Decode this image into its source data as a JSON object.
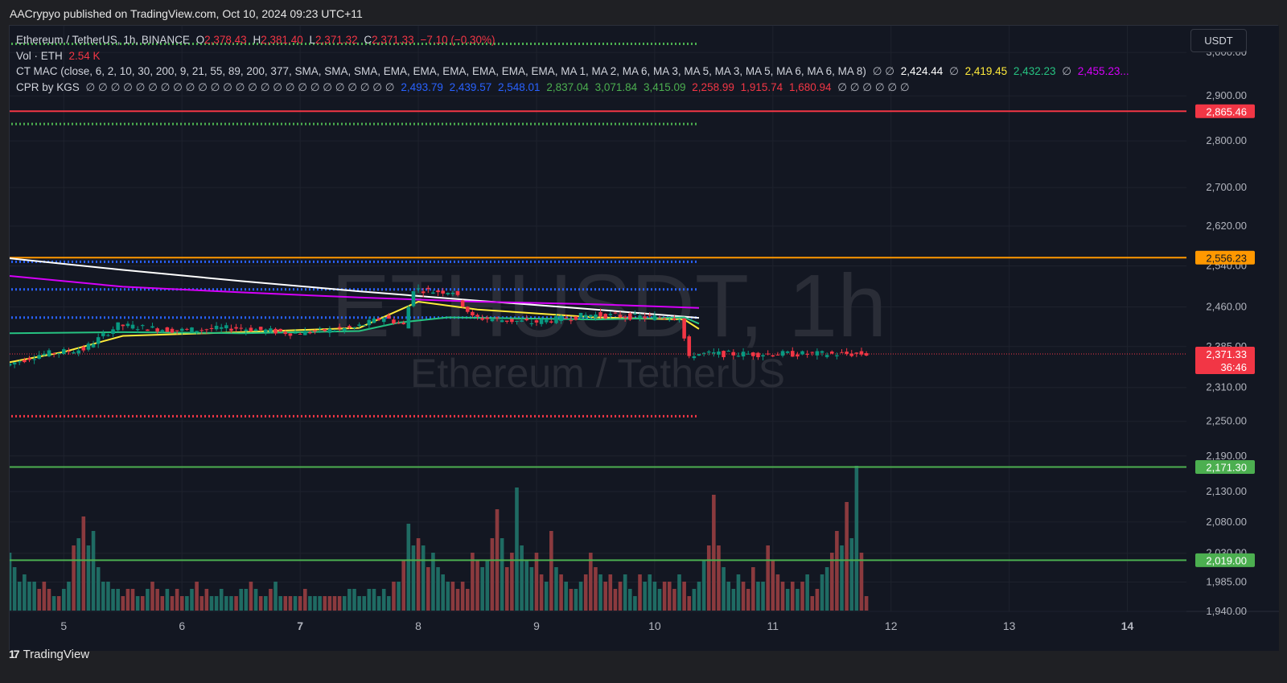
{
  "header": {
    "published_by": "AACrypyo published on TradingView.com, Oct 10, 2024 09:23 UTC+11"
  },
  "footer": {
    "brand": "TradingView",
    "logo_text": "17"
  },
  "currency": "USDT",
  "watermark": {
    "symbol": "ETHUSDT, 1h",
    "name": "Ethereum / TetherUS"
  },
  "legend": {
    "row1": {
      "symbol": "Ethereum / TetherUS, 1h, BINANCE",
      "o_label": "O",
      "o": "2,378.43",
      "h_label": "H",
      "h": "2,381.40",
      "l_label": "L",
      "l": "2,371.32",
      "c_label": "C",
      "c": "2,371.33",
      "change": "−7.10 (−0.30%)"
    },
    "row2": {
      "label": "Vol · ETH",
      "value": "2.54 K"
    },
    "row3": {
      "label": "CT MAC (close, 6, 2, 10, 30, 200, 9, 21, 55, 89, 200, 377, SMA, SMA, SMA, EMA, EMA, EMA, EMA, EMA, EMA, MA 1, MA 2, MA 6, MA 3, MA 5, MA 3, MA 5, MA 6, MA 6, MA 8)",
      "empty1": "∅ ∅",
      "v1": "2,424.44",
      "empty2": "∅",
      "v2": "2,419.45",
      "v3": "2,432.23",
      "empty3": "∅",
      "v4": "2,455.23..."
    },
    "row4": {
      "label": "CPR by KGS",
      "empty1": "∅ ∅ ∅ ∅ ∅ ∅ ∅ ∅ ∅ ∅ ∅ ∅ ∅ ∅ ∅ ∅ ∅ ∅ ∅ ∅ ∅ ∅ ∅ ∅ ∅",
      "b1": "2,493.79",
      "b2": "2,439.57",
      "b3": "2,548.01",
      "g1": "2,837.04",
      "g2": "3,071.84",
      "g3": "3,415.09",
      "r1": "2,258.99",
      "r2": "1,915.74",
      "r3": "1,680.94",
      "empty2": "∅ ∅ ∅ ∅ ∅ ∅"
    }
  },
  "colors": {
    "background": "#131722",
    "grid": "#1e222d",
    "up": "#089981",
    "down": "#f23645",
    "vol_up": "#1f6b63",
    "vol_down": "#8b3a3e",
    "cpr_green": "#4caf50",
    "cpr_blue": "#2962ff",
    "cpr_red": "#f23645",
    "ma_white": "#ffffff",
    "ma_magenta": "#d500f9",
    "ma_yellow": "#ffeb3b",
    "ma_teal": "#26c281",
    "level_red": "#f23645",
    "level_orange": "#ff9800",
    "level_green": "#4caf50"
  },
  "chart_data": {
    "type": "candlestick",
    "title": "Ethereum / TetherUS, 1h, BINANCE",
    "price_axis": {
      "ticks": [
        "3,000.00",
        "2,900.00",
        "2,800.00",
        "2,700.00",
        "2,620.00",
        "2,540.00",
        "2,460.00",
        "2,385.00",
        "2,310.00",
        "2,250.00",
        "2,190.00",
        "2,130.00",
        "2,080.00",
        "2,030.00",
        "1,985.00",
        "1,940.00"
      ],
      "scale": "log",
      "ylim": [
        1940,
        3040
      ]
    },
    "time_axis": {
      "ticks": [
        "5",
        "6",
        "7",
        "8",
        "9",
        "10",
        "11",
        "12",
        "13",
        "14"
      ],
      "bold_ticks": [
        "7",
        "14"
      ],
      "xlim": [
        "2024-10-04T13:00",
        "2024-10-14T12:00"
      ]
    },
    "price_labels": [
      {
        "value": 2865.46,
        "text": "2,865.46",
        "style": "red-line"
      },
      {
        "value": 2556.23,
        "text": "2,556.23",
        "style": "orange-line"
      },
      {
        "value": 2371.33,
        "text": "2,371.33",
        "countdown": "36:46",
        "style": "last-price"
      },
      {
        "value": 2171.3,
        "text": "2,171.30",
        "style": "green-line"
      },
      {
        "value": 2019.0,
        "text": "2,019.00",
        "style": "green-line"
      }
    ],
    "cpr_levels": [
      {
        "value": 3020,
        "color": "green"
      },
      {
        "value": 2837.04,
        "color": "green"
      },
      {
        "value": 2548.01,
        "color": "blue"
      },
      {
        "value": 2493.79,
        "color": "blue"
      },
      {
        "value": 2439.57,
        "color": "blue"
      },
      {
        "value": 2258.99,
        "color": "red"
      }
    ],
    "moving_averages": [
      {
        "color": "white",
        "points": [
          [
            "2024-10-04T13:00",
            2555
          ],
          [
            "2024-10-05T12:00",
            2532
          ],
          [
            "2024-10-06T12:00",
            2510
          ],
          [
            "2024-10-07T12:00",
            2490
          ],
          [
            "2024-10-08T12:00",
            2472
          ],
          [
            "2024-10-09T12:00",
            2455
          ],
          [
            "2024-10-10T09:00",
            2439
          ]
        ]
      },
      {
        "color": "magenta",
        "points": [
          [
            "2024-10-04T13:00",
            2520
          ],
          [
            "2024-10-05T12:00",
            2499
          ],
          [
            "2024-10-06T12:00",
            2488
          ],
          [
            "2024-10-07T12:00",
            2478
          ],
          [
            "2024-10-08T12:00",
            2470
          ],
          [
            "2024-10-09T12:00",
            2465
          ],
          [
            "2024-10-10T09:00",
            2458
          ]
        ]
      },
      {
        "color": "yellow",
        "points": [
          [
            "2024-10-04T13:00",
            2356
          ],
          [
            "2024-10-05T00:00",
            2375
          ],
          [
            "2024-10-05T12:00",
            2405
          ],
          [
            "2024-10-06T12:00",
            2412
          ],
          [
            "2024-10-07T12:00",
            2420
          ],
          [
            "2024-10-08T00:00",
            2470
          ],
          [
            "2024-10-08T12:00",
            2455
          ],
          [
            "2024-10-09T12:00",
            2440
          ],
          [
            "2024-10-10T06:00",
            2436
          ],
          [
            "2024-10-10T09:00",
            2418
          ]
        ]
      },
      {
        "color": "teal",
        "points": [
          [
            "2024-10-04T13:00",
            2410
          ],
          [
            "2024-10-05T12:00",
            2412
          ],
          [
            "2024-10-06T12:00",
            2410
          ],
          [
            "2024-10-07T12:00",
            2414
          ],
          [
            "2024-10-07T20:00",
            2430
          ],
          [
            "2024-10-08T06:00",
            2440
          ],
          [
            "2024-10-09T12:00",
            2436
          ],
          [
            "2024-10-10T06:00",
            2440
          ],
          [
            "2024-10-10T09:00",
            2428
          ]
        ]
      }
    ],
    "candles_anchor": [
      [
        "2024-10-04T13:00",
        2350
      ],
      [
        "2024-10-04T20:00",
        2370
      ],
      [
        "2024-10-05T05:00",
        2380
      ],
      [
        "2024-10-05T12:00",
        2425
      ],
      [
        "2024-10-06T00:00",
        2415
      ],
      [
        "2024-10-06T12:00",
        2420
      ],
      [
        "2024-10-07T00:00",
        2410
      ],
      [
        "2024-10-07T06:00",
        2415
      ],
      [
        "2024-10-07T12:00",
        2420
      ],
      [
        "2024-10-07T18:00",
        2440
      ],
      [
        "2024-10-07T22:00",
        2425
      ],
      [
        "2024-10-08T00:00",
        2495
      ],
      [
        "2024-10-08T04:00",
        2490
      ],
      [
        "2024-10-08T08:00",
        2490
      ],
      [
        "2024-10-08T12:00",
        2440
      ],
      [
        "2024-10-09T00:00",
        2430
      ],
      [
        "2024-10-09T12:00",
        2445
      ],
      [
        "2024-10-10T00:00",
        2440
      ],
      [
        "2024-10-10T06:00",
        2440
      ],
      [
        "2024-10-10T07:00",
        2400
      ],
      [
        "2024-10-10T08:00",
        2362
      ],
      [
        "2024-10-10T09:00",
        2371.33
      ]
    ],
    "volume_profile": [
      0.4,
      0.3,
      0.2,
      0.25,
      0.2,
      0.2,
      0.15,
      0.2,
      0.15,
      0.1,
      0.1,
      0.15,
      0.2,
      0.45,
      0.5,
      0.65,
      0.45,
      0.55,
      0.3,
      0.2,
      0.2,
      0.15,
      0.15,
      0.1,
      0.15,
      0.15,
      0.1,
      0.1,
      0.15,
      0.2,
      0.15,
      0.1,
      0.15,
      0.1,
      0.15,
      0.1,
      0.1,
      0.15,
      0.2,
      0.1,
      0.15,
      0.1,
      0.1,
      0.15,
      0.1,
      0.1,
      0.1,
      0.15,
      0.15,
      0.2,
      0.15,
      0.1,
      0.1,
      0.15,
      0.2,
      0.1,
      0.1,
      0.1,
      0.1,
      0.1,
      0.15,
      0.1,
      0.1,
      0.1,
      0.1,
      0.1,
      0.1,
      0.1,
      0.1,
      0.15,
      0.15,
      0.1,
      0.1,
      0.15,
      0.15,
      0.1,
      0.15,
      0.1,
      0.2,
      0.2,
      0.35,
      0.6,
      0.45,
      0.5,
      0.45,
      0.3,
      0.4,
      0.3,
      0.25,
      0.2,
      0.2,
      0.15,
      0.2,
      0.15,
      0.4,
      0.35,
      0.3,
      0.35,
      0.5,
      0.7,
      0.5,
      0.3,
      0.4,
      0.85,
      0.45,
      0.35,
      0.3,
      0.4,
      0.25,
      0.2,
      0.55,
      0.3,
      0.25,
      0.2,
      0.15,
      0.15,
      0.2,
      0.25,
      0.4,
      0.3,
      0.25,
      0.2,
      0.25,
      0.15,
      0.2,
      0.25,
      0.15,
      0.1,
      0.25,
      0.2,
      0.25,
      0.2,
      0.15,
      0.2,
      0.2,
      0.15,
      0.25,
      0.2,
      0.1,
      0.15,
      0.2,
      0.35,
      0.45,
      0.8,
      0.45,
      0.3,
      0.2,
      0.15,
      0.25,
      0.2,
      0.15,
      0.3,
      0.2,
      0.2,
      0.45,
      0.35,
      0.25,
      0.2,
      0.15,
      0.2,
      0.15,
      0.2,
      0.25,
      0.1,
      0.15,
      0.25,
      0.3,
      0.4,
      0.55,
      0.45,
      0.75,
      0.5,
      1.0,
      0.4,
      0.1
    ]
  }
}
